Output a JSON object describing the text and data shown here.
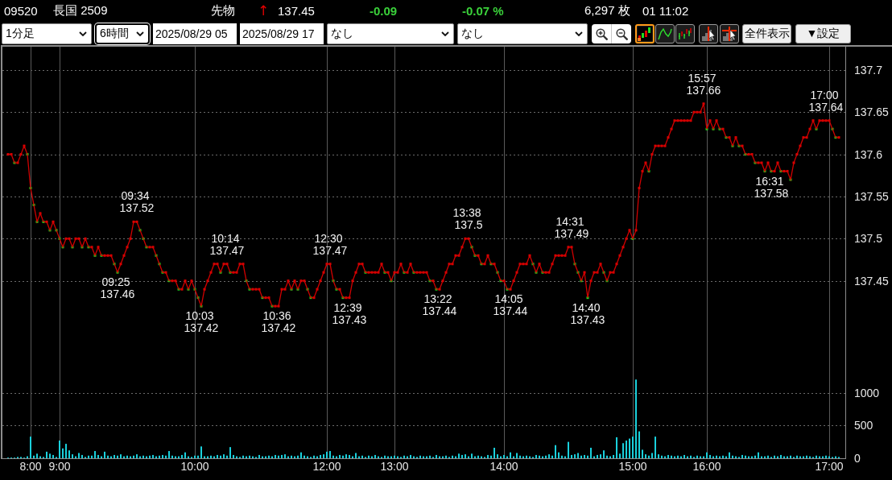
{
  "header": {
    "code": "09520",
    "name": "長国 2509",
    "market": "先物",
    "arrow": "↑",
    "price": "137.45",
    "change": "-0.09",
    "change_percent": "-0.07 %",
    "volume": "6,297 枚",
    "time": "01 11:02"
  },
  "toolbar": {
    "period_select": {
      "value": "1分足",
      "focused": false
    },
    "range_select": {
      "value": "6時間",
      "focused": true
    },
    "start_field": {
      "value": "2025/08/29 05"
    },
    "end_field": {
      "value": "2025/08/29 17"
    },
    "indicator_selects": [
      {
        "value": "なし",
        "focused": false
      },
      {
        "value": "なし",
        "focused": false
      }
    ],
    "zoom_buttons": [
      {
        "kind": "zoom_in"
      },
      {
        "kind": "zoom_out"
      }
    ],
    "chart_types": [
      {
        "kind": "candle",
        "selected": true
      },
      {
        "kind": "line",
        "selected": false
      },
      {
        "kind": "bar",
        "selected": false
      }
    ],
    "cursor_tools": [
      {
        "kind": "vertical_line"
      },
      {
        "kind": "crosshair"
      }
    ],
    "buttons": [
      {
        "label": "全件表示"
      },
      {
        "label": "▼設定"
      }
    ]
  },
  "price_chart": {
    "chart_data": {
      "type": "line",
      "grid": true,
      "ylim": [
        137.3485,
        137.7295
      ],
      "yticks": [
        {
          "value": 137.45,
          "label": "137.45"
        },
        {
          "value": 137.5,
          "label": "137.5"
        },
        {
          "value": 137.55,
          "label": "137.55"
        },
        {
          "value": 137.6,
          "label": "137.6"
        },
        {
          "value": 137.65,
          "label": "137.65"
        },
        {
          "value": 137.7,
          "label": "137.7"
        }
      ],
      "series": [
        {
          "marker": "square",
          "values": [
            137.6,
            137.6,
            137.59,
            137.59,
            137.6,
            137.61,
            137.6,
            137.56,
            137.54,
            137.52,
            137.53,
            137.52,
            137.52,
            137.51,
            137.52,
            137.51,
            137.5,
            137.49,
            137.5,
            137.5,
            137.49,
            137.5,
            137.5,
            137.49,
            137.5,
            137.49,
            137.49,
            137.48,
            137.49,
            137.48,
            137.48,
            137.48,
            137.48,
            137.47,
            137.46,
            137.47,
            137.48,
            137.49,
            137.5,
            137.52,
            137.52,
            137.51,
            137.5,
            137.49,
            137.49,
            137.49,
            137.48,
            137.47,
            137.46,
            137.46,
            137.45,
            137.45,
            137.45,
            137.44,
            137.44,
            137.45,
            137.44,
            137.45,
            137.44,
            137.43,
            137.42,
            137.44,
            137.45,
            137.46,
            137.47,
            137.47,
            137.46,
            137.47,
            137.47,
            137.46,
            137.46,
            137.46,
            137.47,
            137.47,
            137.45,
            137.44,
            137.44,
            137.44,
            137.44,
            137.43,
            137.43,
            137.43,
            137.42,
            137.42,
            137.42,
            137.44,
            137.44,
            137.45,
            137.44,
            137.45,
            137.44,
            137.45,
            137.45,
            137.44,
            137.43,
            137.43,
            137.44,
            137.45,
            137.46,
            137.47,
            137.47,
            137.45,
            137.44,
            137.44,
            137.43,
            137.43,
            137.43,
            137.45,
            137.46,
            137.47,
            137.47,
            137.46,
            137.46,
            137.46,
            137.46,
            137.46,
            137.47,
            137.46,
            137.46,
            137.45,
            137.46,
            137.46,
            137.47,
            137.46,
            137.46,
            137.47,
            137.46,
            137.46,
            137.46,
            137.46,
            137.46,
            137.45,
            137.45,
            137.44,
            137.44,
            137.45,
            137.46,
            137.47,
            137.47,
            137.48,
            137.48,
            137.49,
            137.5,
            137.5,
            137.49,
            137.48,
            137.48,
            137.47,
            137.47,
            137.48,
            137.47,
            137.47,
            137.46,
            137.45,
            137.45,
            137.44,
            137.44,
            137.45,
            137.46,
            137.47,
            137.47,
            137.47,
            137.48,
            137.47,
            137.46,
            137.47,
            137.46,
            137.46,
            137.46,
            137.47,
            137.48,
            137.48,
            137.48,
            137.48,
            137.49,
            137.49,
            137.47,
            137.46,
            137.45,
            137.46,
            137.43,
            137.45,
            137.46,
            137.46,
            137.47,
            137.46,
            137.45,
            137.46,
            137.46,
            137.47,
            137.48,
            137.49,
            137.5,
            137.51,
            137.5,
            137.51,
            137.56,
            137.58,
            137.59,
            137.58,
            137.6,
            137.61,
            137.61,
            137.61,
            137.61,
            137.62,
            137.63,
            137.64,
            137.64,
            137.64,
            137.64,
            137.64,
            137.64,
            137.65,
            137.65,
            137.65,
            137.66,
            137.63,
            137.64,
            137.63,
            137.64,
            137.63,
            137.63,
            137.62,
            137.62,
            137.61,
            137.62,
            137.61,
            137.61,
            137.6,
            137.6,
            137.6,
            137.59,
            137.59,
            137.59,
            137.58,
            137.59,
            137.58,
            137.58,
            137.59,
            137.58,
            137.58,
            137.58,
            137.57,
            137.59,
            137.6,
            137.61,
            137.62,
            137.62,
            137.63,
            137.64,
            137.63,
            137.64,
            137.64,
            137.64,
            137.64,
            137.63,
            137.62,
            137.62
          ]
        }
      ],
      "annotations": [
        "09:25\n137.46",
        "09:34\n137.52",
        "10:03\n137.42",
        "10:14\n137.47",
        "10:36\n137.42",
        "12:30\n137.47",
        "12:39\n137.43",
        "13:22\n137.44",
        "13:38\n137.5",
        "14:05\n137.44",
        "14:31\n137.49",
        "14:40\n137.43",
        "15:57\n137.66",
        "16:31\n137.58",
        "17:00\n137.64"
      ]
    }
  },
  "volume_chart": {
    "chart_data": {
      "type": "bar",
      "grid": true,
      "categories": [
        null,
        null,
        null,
        null,
        null,
        null,
        null,
        "8:00",
        null,
        null,
        null,
        null,
        null,
        null,
        null,
        null,
        "9:00",
        null,
        null,
        null,
        null,
        null,
        null,
        null,
        null,
        null,
        null,
        null,
        null,
        null,
        null,
        null,
        null,
        null,
        null,
        null,
        null,
        null,
        null,
        null,
        null,
        null,
        null,
        null,
        null,
        null,
        null,
        null,
        null,
        null,
        null,
        null,
        null,
        null,
        null,
        null,
        null,
        null,
        "10:00",
        null,
        null,
        null,
        null,
        null,
        null,
        null,
        null,
        null,
        null,
        null,
        null,
        null,
        null,
        null,
        null,
        null,
        null,
        null,
        null,
        null,
        null,
        null,
        null,
        null,
        null,
        null,
        null,
        null,
        null,
        null,
        null,
        null,
        null,
        null,
        null,
        null,
        null,
        null,
        null,
        "12:00",
        null,
        null,
        null,
        null,
        null,
        null,
        null,
        null,
        null,
        null,
        null,
        null,
        null,
        null,
        null,
        null,
        null,
        null,
        null,
        null,
        "13:00",
        null,
        null,
        null,
        null,
        null,
        null,
        null,
        null,
        null,
        null,
        null,
        null,
        null,
        null,
        null,
        null,
        null,
        null,
        null,
        null,
        null,
        null,
        null,
        null,
        null,
        null,
        null,
        null,
        null,
        null,
        null,
        null,
        null,
        "14:00",
        null,
        null,
        null,
        null,
        null,
        null,
        null,
        null,
        null,
        null,
        null,
        null,
        null,
        null,
        null,
        null,
        null,
        null,
        null,
        null,
        null,
        null,
        null,
        null,
        null,
        null,
        null,
        null,
        null,
        null,
        null,
        null,
        null,
        null,
        null,
        null,
        null,
        null,
        null,
        "15:00",
        null,
        null,
        null,
        null,
        null,
        null,
        null,
        null,
        null,
        null,
        null,
        null,
        null,
        null,
        null,
        null,
        null,
        null,
        null,
        null,
        null,
        null,
        "16:00",
        null,
        null,
        null,
        null,
        null,
        null,
        null,
        null,
        null,
        null,
        null,
        null,
        null,
        null,
        null,
        null,
        null,
        null,
        null,
        null,
        null,
        null,
        null,
        null,
        null,
        null,
        null,
        null,
        null,
        null,
        null,
        null,
        null,
        null,
        null,
        null,
        null,
        "17:00",
        null,
        null,
        null
      ],
      "ylim": [
        0,
        1400
      ],
      "yticks": [
        0,
        500,
        1000
      ],
      "series": [
        {
          "color": "#1ad0dc",
          "values": [
            10,
            10,
            10,
            20,
            20,
            10,
            30,
            330,
            40,
            70,
            30,
            20,
            100,
            70,
            50,
            20,
            270,
            150,
            220,
            120,
            60,
            30,
            80,
            50,
            20,
            40,
            40,
            110,
            50,
            30,
            100,
            40,
            30,
            50,
            40,
            60,
            30,
            40,
            30,
            40,
            60,
            30,
            40,
            30,
            40,
            50,
            30,
            40,
            50,
            40,
            110,
            40,
            30,
            30,
            50,
            90,
            30,
            20,
            40,
            40,
            180,
            30,
            30,
            40,
            30,
            50,
            40,
            60,
            40,
            170,
            50,
            30,
            20,
            40,
            30,
            40,
            30,
            20,
            50,
            30,
            30,
            40,
            30,
            50,
            40,
            50,
            60,
            30,
            40,
            30,
            40,
            90,
            40,
            30,
            20,
            40,
            30,
            50,
            60,
            100,
            110,
            40,
            30,
            50,
            40,
            60,
            50,
            30,
            80,
            30,
            40,
            20,
            40,
            30,
            50,
            30,
            20,
            40,
            30,
            30,
            40,
            30,
            20,
            40,
            30,
            50,
            30,
            20,
            40,
            30,
            30,
            40,
            20,
            50,
            30,
            30,
            40,
            20,
            40,
            30,
            70,
            50,
            60,
            30,
            70,
            30,
            40,
            30,
            20,
            50,
            40,
            160,
            60,
            30,
            50,
            30,
            90,
            30,
            80,
            40,
            30,
            40,
            30,
            20,
            50,
            40,
            30,
            40,
            60,
            40,
            200,
            90,
            40,
            30,
            250,
            50,
            60,
            80,
            40,
            50,
            40,
            160,
            30,
            50,
            60,
            120,
            40,
            30,
            50,
            320,
            70,
            230,
            270,
            300,
            330,
            1200,
            410,
            130,
            60,
            40,
            80,
            330,
            60,
            40,
            30,
            50,
            40,
            30,
            40,
            30,
            50,
            30,
            40,
            20,
            40,
            30,
            30,
            90,
            50,
            30,
            40,
            30,
            40,
            30,
            90,
            40,
            30,
            20,
            50,
            40,
            30,
            30,
            40,
            90,
            30,
            30,
            40,
            20,
            40,
            30,
            50,
            30,
            30,
            40,
            20,
            40,
            30,
            30,
            40,
            30,
            20,
            40,
            30,
            30,
            40,
            30,
            20,
            30,
            20
          ]
        }
      ]
    }
  }
}
